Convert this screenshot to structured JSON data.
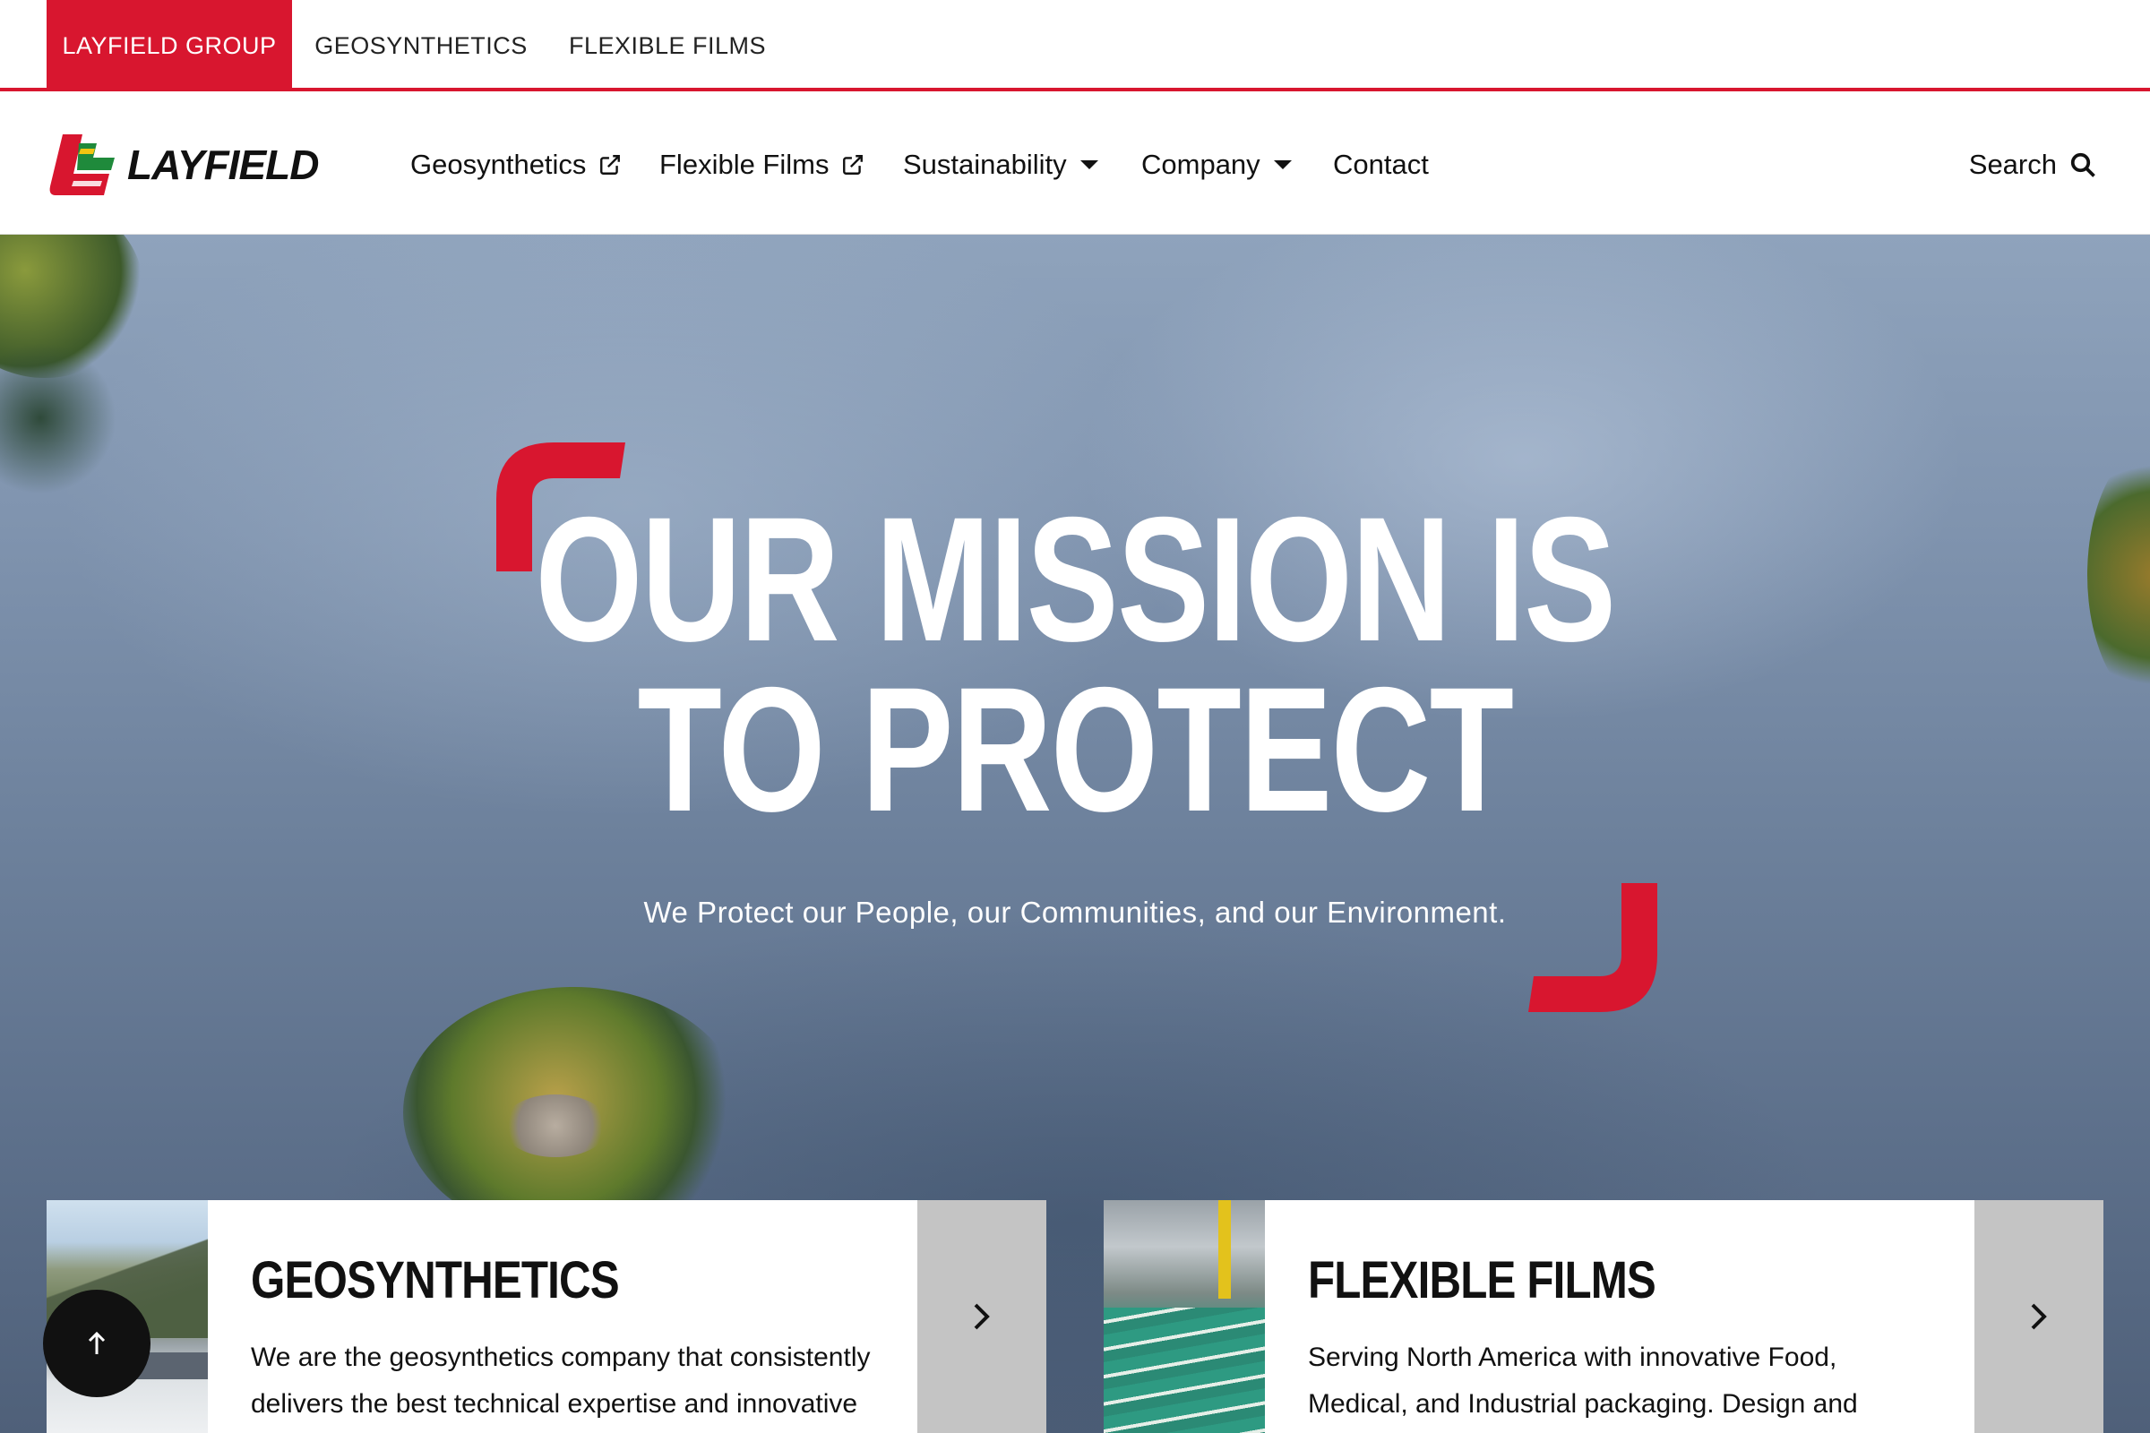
{
  "colors": {
    "brand_red": "#d8162f",
    "text": "#111111",
    "card_arrow_bg": "#c4c4c4"
  },
  "topbar": {
    "tabs": [
      {
        "label": "LAYFIELD GROUP",
        "active": true
      },
      {
        "label": "GEOSYNTHETICS",
        "active": false
      },
      {
        "label": "FLEXIBLE FILMS",
        "active": false
      }
    ]
  },
  "header": {
    "logo_text": "LAYFIELD",
    "nav": [
      {
        "label": "Geosynthetics",
        "icon": "external-link-icon"
      },
      {
        "label": "Flexible Films",
        "icon": "external-link-icon"
      },
      {
        "label": "Sustainability",
        "icon": "caret-down-icon"
      },
      {
        "label": "Company",
        "icon": "caret-down-icon"
      },
      {
        "label": "Contact"
      }
    ],
    "search_label": "Search"
  },
  "hero": {
    "title_line1": "OUR MISSION IS",
    "title_line2": "TO PROTECT",
    "subtitle": "We Protect our People, our Communities, and our Environment."
  },
  "cards": [
    {
      "title": "GEOSYNTHETICS",
      "body": "We are the geosynthetics company that consistently delivers the best technical expertise and innovative"
    },
    {
      "title": "FLEXIBLE FILMS",
      "body": "Serving North America with innovative Food, Medical, and Industrial packaging. Design and"
    }
  ]
}
